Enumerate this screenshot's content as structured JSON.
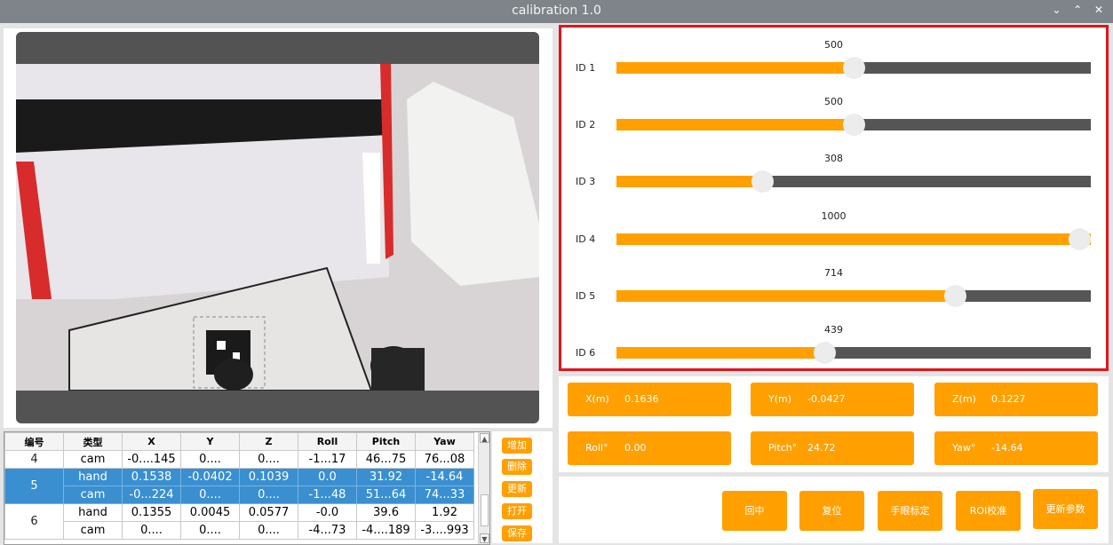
{
  "window": {
    "title": "calibration 1.0",
    "controls": [
      "⌄",
      "⌃",
      "✕"
    ]
  },
  "camera": {
    "label": "camera-feed"
  },
  "table": {
    "headers": [
      "编号",
      "类型",
      "X",
      "Y",
      "Z",
      "Roll",
      "Pitch",
      "Yaw"
    ],
    "groups": [
      {
        "id": "4",
        "selected": false,
        "rows": [
          [
            "cam",
            "-0....145",
            "0....",
            "0....",
            "-1...17",
            "46...75",
            "76...08"
          ]
        ]
      },
      {
        "id": "5",
        "selected": true,
        "rows": [
          [
            "hand",
            "0.1538",
            "-0.0402",
            "0.1039",
            "0.0",
            "31.92",
            "-14.64"
          ],
          [
            "cam",
            "-0...224",
            "0....",
            "0....",
            "-1...48",
            "51...64",
            "74...33"
          ]
        ]
      },
      {
        "id": "6",
        "selected": false,
        "rows": [
          [
            "hand",
            "0.1355",
            "0.0045",
            "0.0577",
            "-0.0",
            "39.6",
            "1.92"
          ],
          [
            "cam",
            "0....",
            "0....",
            "0....",
            "-4...73",
            "-4....189",
            "-3....993"
          ]
        ]
      }
    ]
  },
  "side_buttons": [
    "增加",
    "删除",
    "更新",
    "打开",
    "保存"
  ],
  "servos": [
    {
      "label": "ID 1",
      "value": "500",
      "fraction": 0.5
    },
    {
      "label": "ID 2",
      "value": "500",
      "fraction": 0.5
    },
    {
      "label": "ID 3",
      "value": "308",
      "fraction": 0.308
    },
    {
      "label": "ID 4",
      "value": "1000",
      "fraction": 1.0
    },
    {
      "label": "ID 5",
      "value": "714",
      "fraction": 0.714
    },
    {
      "label": "ID 6",
      "value": "439",
      "fraction": 0.439
    }
  ],
  "pose": [
    {
      "label": "X(m)",
      "value": "0.1636"
    },
    {
      "label": "Y(m)",
      "value": "-0.0427"
    },
    {
      "label": "Z(m)",
      "value": "0.1227"
    },
    {
      "label": "Roll°",
      "value": "0.00"
    },
    {
      "label": "Pitch°",
      "value": "24.72"
    },
    {
      "label": "Yaw°",
      "value": "-14.64"
    }
  ],
  "actions": [
    "回中",
    "复位",
    "手眼标定",
    "ROI校准",
    "更新参数"
  ],
  "colors": {
    "accent": "#ffa000",
    "track": "#555555",
    "selection": "#3a8fd0",
    "highlight_border": "#e0141c"
  }
}
